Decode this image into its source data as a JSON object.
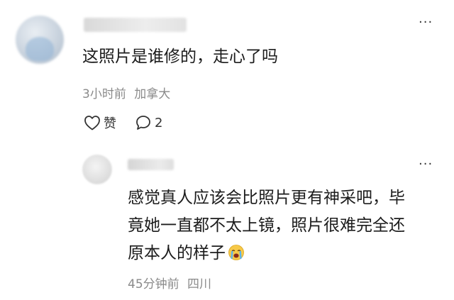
{
  "comment": {
    "username": "",
    "text": "这照片是谁修的，走心了吗",
    "time": "3小时前",
    "location": "加拿大",
    "more_label": "···",
    "like": {
      "label": "赞",
      "icon": "heart-outline-icon"
    },
    "reply": {
      "count": "2",
      "icon": "speech-bubble-icon"
    }
  },
  "reply": {
    "username": "",
    "lines": [
      "感觉真人应该会比照片更有神采吧，毕",
      "竟她一直都不太上镜，照片很难完全还",
      "原本人的样子"
    ],
    "emoji": "crying-face-emoji",
    "time": "45分钟前",
    "location": "四川",
    "more_label": "···"
  },
  "colors": {
    "text_primary": "#1c1c1c",
    "text_meta": "#8a8a8a",
    "background": "#ffffff"
  }
}
